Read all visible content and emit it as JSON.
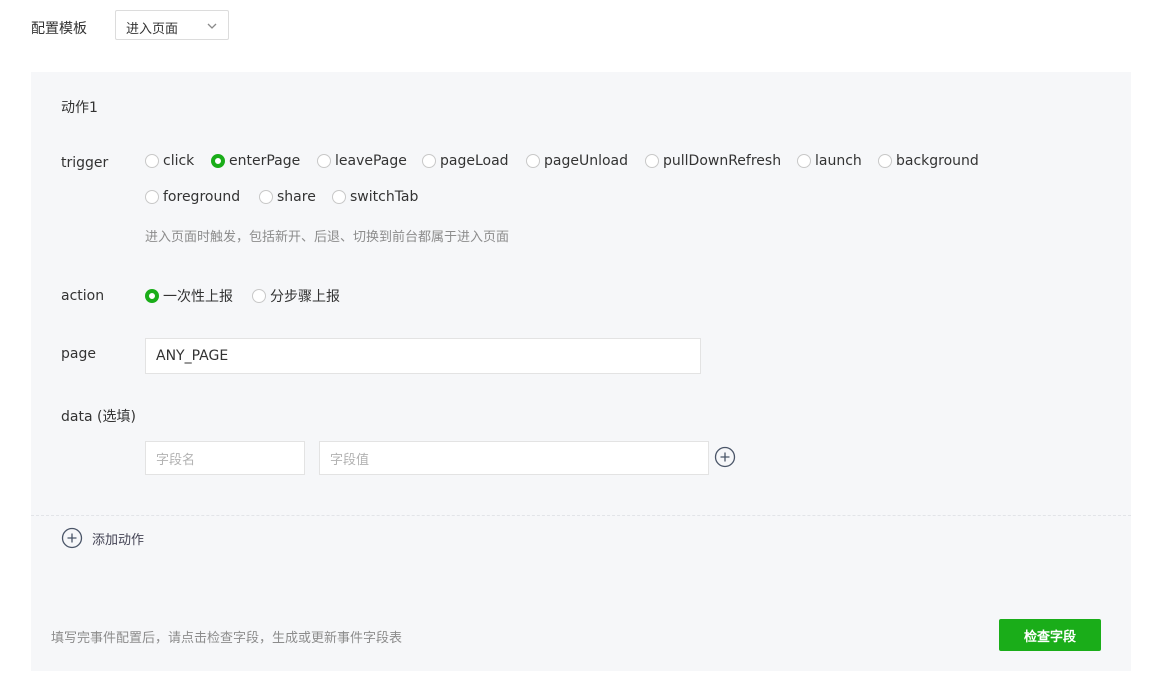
{
  "template": {
    "label": "配置模板",
    "selected": "进入页面"
  },
  "action_block": {
    "title": "动作1",
    "trigger": {
      "label": "trigger",
      "options": [
        "click",
        "enterPage",
        "leavePage",
        "pageLoad",
        "pageUnload",
        "pullDownRefresh",
        "launch",
        "background",
        "foreground",
        "share",
        "switchTab"
      ],
      "selected": "enterPage",
      "hint": "进入页面时触发，包括新开、后退、切换到前台都属于进入页面"
    },
    "action": {
      "label": "action",
      "options": [
        "一次性上报",
        "分步骤上报"
      ],
      "selected": "一次性上报"
    },
    "page": {
      "label": "page",
      "value": "ANY_PAGE"
    },
    "data": {
      "label": "data (选填)",
      "field_name_placeholder": "字段名",
      "field_value_placeholder": "字段值"
    }
  },
  "add_action_label": "添加动作",
  "footer": {
    "hint": "填写完事件配置后，请点击检查字段，生成或更新事件字段表",
    "check_button": "检查字段"
  },
  "colors": {
    "accent": "#1aad19",
    "panel_bg": "#f6f7f9"
  }
}
